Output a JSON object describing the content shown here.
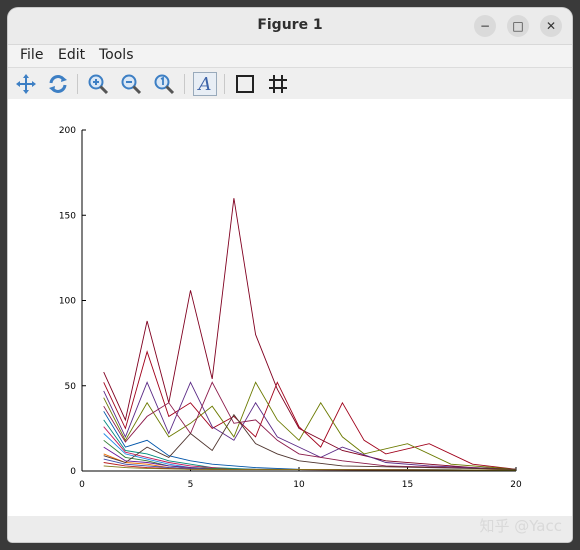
{
  "window": {
    "title": "Figure 1"
  },
  "window_controls": {
    "minimize": "−",
    "maximize": "□",
    "close": "✕"
  },
  "menu": {
    "file": "File",
    "edit": "Edit",
    "tools": "Tools"
  },
  "toolbar": {
    "icons": [
      "pan-icon",
      "rotate-icon",
      "zoom-in-icon",
      "zoom-out-icon",
      "zoom-reset-icon",
      "text-icon",
      "axes-box-icon",
      "grid-icon"
    ],
    "text_glyph": "A"
  },
  "watermark": "知乎 @Yacc",
  "chart_data": {
    "type": "line",
    "xlim": [
      0,
      20
    ],
    "ylim": [
      0,
      200
    ],
    "xticks": [
      0,
      5,
      10,
      15,
      20
    ],
    "yticks": [
      0,
      50,
      100,
      150,
      200
    ],
    "grid": false,
    "title": "",
    "xlabel": "",
    "ylabel": "",
    "series": [
      {
        "color": "#800020",
        "points": [
          [
            1,
            58
          ],
          [
            2,
            30
          ],
          [
            3,
            88
          ],
          [
            4,
            40
          ],
          [
            5,
            106
          ],
          [
            6,
            54
          ],
          [
            7,
            160
          ],
          [
            8,
            80
          ],
          [
            9,
            48
          ],
          [
            10,
            25
          ],
          [
            12,
            12
          ],
          [
            14,
            6
          ],
          [
            16,
            4
          ],
          [
            18,
            2
          ],
          [
            20,
            1
          ]
        ]
      },
      {
        "color": "#a0001a",
        "points": [
          [
            1,
            52
          ],
          [
            2,
            25
          ],
          [
            3,
            70
          ],
          [
            4,
            32
          ],
          [
            5,
            40
          ],
          [
            6,
            25
          ],
          [
            7,
            32
          ],
          [
            8,
            20
          ],
          [
            9,
            52
          ],
          [
            10,
            26
          ],
          [
            11,
            14
          ],
          [
            12,
            40
          ],
          [
            13,
            18
          ],
          [
            14,
            10
          ],
          [
            16,
            16
          ],
          [
            18,
            4
          ],
          [
            20,
            1
          ]
        ]
      },
      {
        "color": "#5b2a86",
        "points": [
          [
            1,
            47
          ],
          [
            2,
            20
          ],
          [
            3,
            52
          ],
          [
            4,
            22
          ],
          [
            5,
            52
          ],
          [
            6,
            26
          ],
          [
            7,
            18
          ],
          [
            8,
            40
          ],
          [
            9,
            20
          ],
          [
            10,
            14
          ],
          [
            11,
            8
          ],
          [
            12,
            14
          ],
          [
            14,
            5
          ],
          [
            16,
            3
          ],
          [
            20,
            1
          ]
        ]
      },
      {
        "color": "#6b7a00",
        "points": [
          [
            1,
            43
          ],
          [
            2,
            18
          ],
          [
            3,
            40
          ],
          [
            4,
            20
          ],
          [
            5,
            28
          ],
          [
            6,
            38
          ],
          [
            7,
            20
          ],
          [
            8,
            52
          ],
          [
            9,
            30
          ],
          [
            10,
            18
          ],
          [
            11,
            40
          ],
          [
            12,
            20
          ],
          [
            13,
            10
          ],
          [
            15,
            16
          ],
          [
            17,
            4
          ],
          [
            20,
            1
          ]
        ]
      },
      {
        "color": "#8b1a4a",
        "points": [
          [
            1,
            38
          ],
          [
            2,
            17
          ],
          [
            3,
            32
          ],
          [
            4,
            40
          ],
          [
            5,
            22
          ],
          [
            6,
            52
          ],
          [
            7,
            28
          ],
          [
            8,
            30
          ],
          [
            9,
            18
          ],
          [
            10,
            10
          ],
          [
            12,
            6
          ],
          [
            14,
            3
          ],
          [
            20,
            1
          ]
        ]
      },
      {
        "color": "#0055aa",
        "points": [
          [
            1,
            35
          ],
          [
            2,
            14
          ],
          [
            3,
            18
          ],
          [
            4,
            9
          ],
          [
            5,
            6
          ],
          [
            6,
            4
          ],
          [
            8,
            2
          ],
          [
            10,
            1
          ],
          [
            20,
            0.5
          ]
        ]
      },
      {
        "color": "#00897b",
        "points": [
          [
            1,
            30
          ],
          [
            2,
            12
          ],
          [
            3,
            10
          ],
          [
            4,
            6
          ],
          [
            5,
            4
          ],
          [
            6,
            2
          ],
          [
            8,
            1
          ],
          [
            20,
            0.5
          ]
        ]
      },
      {
        "color": "#c2185b",
        "points": [
          [
            1,
            26
          ],
          [
            2,
            11
          ],
          [
            3,
            8
          ],
          [
            4,
            5
          ],
          [
            5,
            3
          ],
          [
            7,
            1
          ],
          [
            20,
            0.5
          ]
        ]
      },
      {
        "color": "#1e88e5",
        "points": [
          [
            1,
            22
          ],
          [
            2,
            10
          ],
          [
            3,
            7
          ],
          [
            4,
            4
          ],
          [
            5,
            2
          ],
          [
            7,
            1
          ],
          [
            20,
            0.5
          ]
        ]
      },
      {
        "color": "#2e7d32",
        "points": [
          [
            1,
            18
          ],
          [
            2,
            8
          ],
          [
            3,
            6
          ],
          [
            4,
            3
          ],
          [
            5,
            2
          ],
          [
            7,
            1
          ],
          [
            20,
            0.5
          ]
        ]
      },
      {
        "color": "#6a1b9a",
        "points": [
          [
            1,
            14
          ],
          [
            2,
            6
          ],
          [
            3,
            5
          ],
          [
            4,
            3
          ],
          [
            6,
            1
          ],
          [
            20,
            0.5
          ]
        ]
      },
      {
        "color": "#ef6c00",
        "points": [
          [
            1,
            10
          ],
          [
            2,
            5
          ],
          [
            3,
            4
          ],
          [
            4,
            2
          ],
          [
            6,
            1
          ],
          [
            20,
            0.5
          ]
        ]
      },
      {
        "color": "#3949ab",
        "points": [
          [
            1,
            7
          ],
          [
            2,
            4
          ],
          [
            3,
            3
          ],
          [
            4,
            2
          ],
          [
            6,
            1
          ],
          [
            20,
            0.5
          ]
        ]
      },
      {
        "color": "#b71c1c",
        "points": [
          [
            1,
            5
          ],
          [
            2,
            3
          ],
          [
            3,
            2
          ],
          [
            5,
            1
          ],
          [
            20,
            0.5
          ]
        ]
      },
      {
        "color": "#827717",
        "points": [
          [
            1,
            3
          ],
          [
            2,
            2
          ],
          [
            3,
            1.5
          ],
          [
            5,
            1
          ],
          [
            20,
            0.5
          ]
        ]
      },
      {
        "color": "#4e342e",
        "points": [
          [
            1,
            9
          ],
          [
            2,
            5
          ],
          [
            3,
            14
          ],
          [
            4,
            8
          ],
          [
            5,
            22
          ],
          [
            6,
            12
          ],
          [
            7,
            33
          ],
          [
            8,
            16
          ],
          [
            9,
            10
          ],
          [
            10,
            6
          ],
          [
            12,
            3
          ],
          [
            20,
            1
          ]
        ]
      }
    ]
  }
}
